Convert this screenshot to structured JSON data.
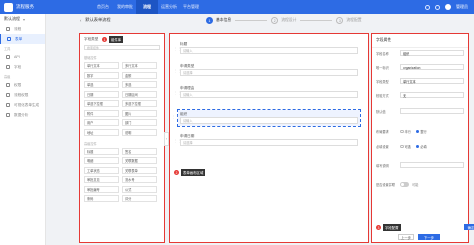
{
  "topbar": {
    "app_title": "流程服务",
    "nav": [
      "首页台",
      "我的审批",
      "流程",
      "运营分析",
      "平台管理"
    ],
    "active_nav_index": 2,
    "user": "管理员"
  },
  "sidebar": {
    "header": "默认流程",
    "items": [
      {
        "label": "流程",
        "group": false,
        "active": false
      },
      {
        "label": "表单",
        "group": false,
        "active": true
      },
      {
        "label": "工具",
        "group": true,
        "active": false
      },
      {
        "label": "API",
        "group": false,
        "active": false
      },
      {
        "label": "字段",
        "group": false,
        "active": false
      },
      {
        "label": "高级",
        "group": true,
        "active": false
      },
      {
        "label": "权限",
        "group": false,
        "active": false
      },
      {
        "label": "流程权限",
        "group": false,
        "active": false
      },
      {
        "label": "可视化表单生成",
        "group": false,
        "active": false
      },
      {
        "label": "数据分析",
        "group": false,
        "active": false
      }
    ]
  },
  "titlebar": {
    "back": "‹",
    "title": "默认表单流程"
  },
  "steps": [
    {
      "num": "1",
      "label": "基本信息",
      "active": true
    },
    {
      "num": "2",
      "label": "流程设计",
      "active": false
    },
    {
      "num": "3",
      "label": "流程配置",
      "active": false
    }
  ],
  "components": {
    "title": "字段类型",
    "search_placeholder": "搜索控件",
    "group1_title": "基础控件",
    "group1": [
      "单行文本",
      "多行文本",
      "数字",
      "金额",
      "单选",
      "多选",
      "日期",
      "日期区间",
      "单选下拉框",
      "多选下拉框",
      "附件",
      "图片",
      "用户",
      "部门",
      "地址",
      "说明"
    ],
    "group2_title": "高级控件",
    "group2": [
      "标题",
      "签名",
      "明细",
      "关联数据",
      "工单状态",
      "关联表单",
      "审批意见",
      "流水号",
      "审批编号",
      "公式",
      "条码",
      "评分"
    ]
  },
  "canvas": {
    "fields": [
      {
        "label": "标题",
        "placeholder": "请输入",
        "selected": false
      },
      {
        "label": "申请类型",
        "placeholder": "请选择",
        "selected": false
      },
      {
        "label": "申请理由",
        "placeholder": "请输入",
        "selected": false
      },
      {
        "label": "组织",
        "placeholder": "请输入",
        "selected": true
      },
      {
        "label": "申请日期",
        "placeholder": "请选择",
        "selected": false
      }
    ]
  },
  "properties": {
    "title": "字段属性",
    "name_label": "字段名称",
    "name_value": "组织",
    "id_label": "唯一标识",
    "id_value": "organization",
    "type_label": "字段类型",
    "type_value": "单行文本",
    "check_label": "校验方式",
    "check_value": "无",
    "default_label": "默认值",
    "default_value": "",
    "layout_label": "布局要求",
    "layout_options": [
      "半行",
      "整行"
    ],
    "required_label": "必填设置",
    "required_options": [
      "可选",
      "必填"
    ],
    "hint_label": "填写说明",
    "hint_value": "",
    "show_label": "是否设置并联",
    "show_value": "可能",
    "confirm": "确定",
    "reset": "重置"
  },
  "callouts": {
    "c1": {
      "num": "1",
      "text": "组件库"
    },
    "c2": {
      "num": "2",
      "text": "表单画布区域"
    },
    "c3": {
      "num": "3",
      "text": "字段配置"
    }
  },
  "footer": {
    "prev": "上一步",
    "next": "下一步"
  }
}
